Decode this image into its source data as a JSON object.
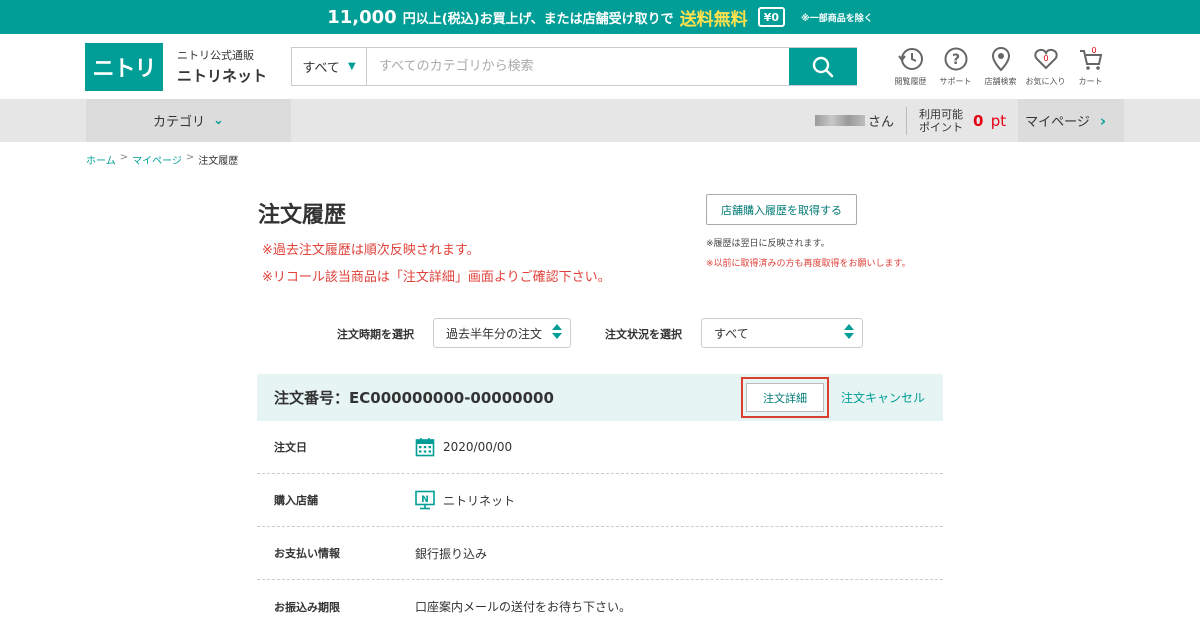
{
  "promo": {
    "amount": "11,000",
    "text1": "円以上(税込)お買上げ、または店舗受け取りで",
    "free_label": "送料無料",
    "truck_label": "¥0",
    "note": "※一部商品を除く"
  },
  "header": {
    "logo_text": "ニトリ",
    "brand_small": "ニトリ公式通販",
    "brand_name": "ニトリネット",
    "search_category": "すべて",
    "search_placeholder": "すべてのカテゴリから検索",
    "icons": [
      {
        "label": "閲覧履歴",
        "icon": "history-icon"
      },
      {
        "label": "サポート",
        "icon": "help-icon"
      },
      {
        "label": "店舗検索",
        "icon": "location-pin-icon"
      },
      {
        "label": "お気に入り",
        "icon": "heart-icon",
        "badge": "0"
      },
      {
        "label": "カート",
        "icon": "cart-icon",
        "badge": "0"
      }
    ]
  },
  "nav": {
    "category_label": "カテゴリ",
    "user_suffix": "さん",
    "points_label_line1": "利用可能",
    "points_label_line2": "ポイント",
    "points_value": "0",
    "points_unit": "pt",
    "mypage_label": "マイページ"
  },
  "breadcrumb": {
    "home": "ホーム",
    "mypage": "マイページ",
    "current": "注文履歴",
    "sep": ">"
  },
  "main": {
    "title": "注文履歴",
    "notice1": "※過去注文履歴は順次反映されます。",
    "notice2": "※リコール該当商品は「注文詳細」画面よりご確認下さい。",
    "store_button": "店舗購入履歴を取得する",
    "store_note1": "※履歴は翌日に反映されます。",
    "store_note2": "※以前に取得済みの方も再度取得をお願いします。",
    "period_label": "注文時期を選択",
    "period_value": "過去半年分の注文",
    "status_label": "注文状況を選択",
    "status_value": "すべて"
  },
  "order": {
    "number_label": "注文番号：EC000000000-00000000",
    "detail_button": "注文詳細",
    "cancel_link": "注文キャンセル",
    "rows": [
      {
        "label": "注文日",
        "value": "2020/00/00"
      },
      {
        "label": "購入店舗",
        "value": "ニトリネット"
      },
      {
        "label": "お支払い情報",
        "value": "銀行振り込み"
      },
      {
        "label": "お振込み期限",
        "value": "口座案内メールの送付をお待ち下さい。"
      }
    ]
  },
  "colors": {
    "brand": "#009e96",
    "accent_red": "#e0413a",
    "highlight_box": "#d9402f"
  }
}
